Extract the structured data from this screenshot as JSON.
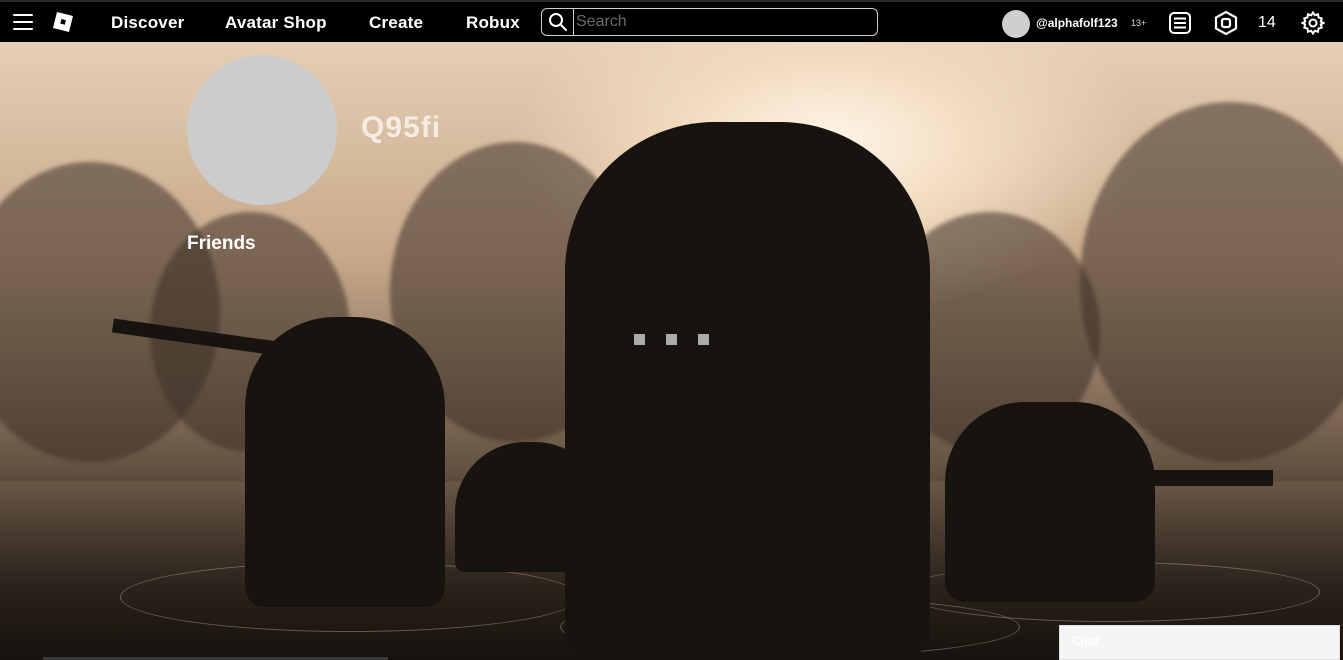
{
  "topbar": {
    "menu_icon": "hamburger-icon",
    "logo_icon": "roblox-logo-icon",
    "nav": [
      {
        "label": "Discover"
      },
      {
        "label": "Avatar Shop"
      },
      {
        "label": "Create"
      },
      {
        "label": "Robux"
      }
    ],
    "search": {
      "placeholder": "Search",
      "value": "",
      "icon": "search-icon"
    },
    "user": {
      "username": "@alphafolf123",
      "age_badge": "13+"
    },
    "messages_icon": "messages-list-icon",
    "robux_icon": "robux-icon",
    "robux_count": "14",
    "settings_icon": "gear-icon"
  },
  "profile": {
    "display_name": "Q95fi",
    "friends_label": "Friends"
  },
  "loading_indicator": {
    "dots": 3,
    "color": "#aaaaaa"
  },
  "chat": {
    "label": "Chat"
  },
  "colors": {
    "topbar_bg": "#000000",
    "text": "#ffffff",
    "avatar_placeholder": "#cccccc"
  }
}
